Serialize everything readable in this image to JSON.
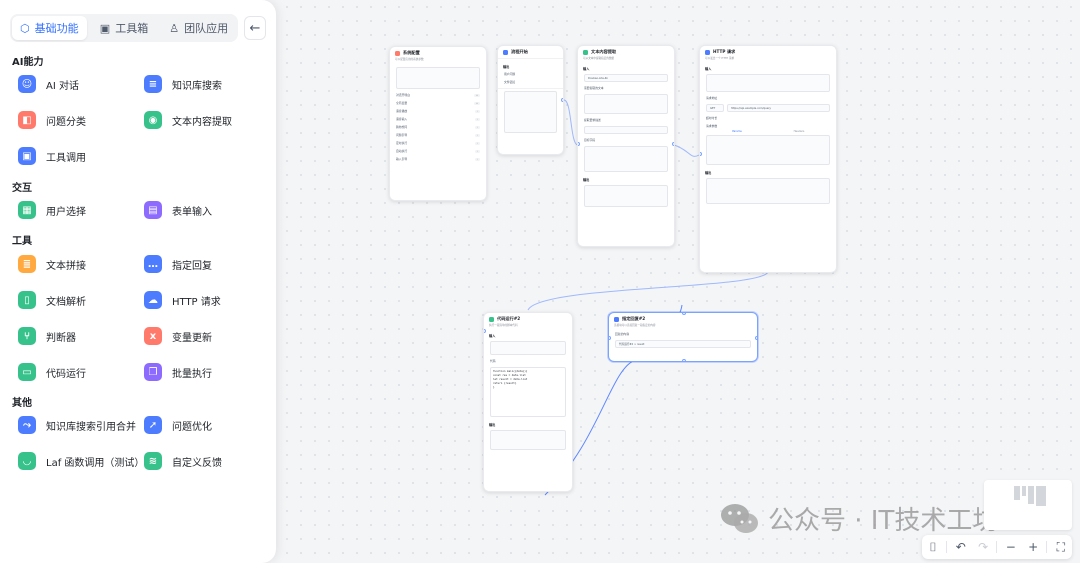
{
  "tabs": [
    {
      "label": "基础功能",
      "icon": "cube-icon",
      "active": true
    },
    {
      "label": "工具箱",
      "icon": "toolbox-icon",
      "active": false
    },
    {
      "label": "团队应用",
      "icon": "user-icon",
      "active": false
    }
  ],
  "sections": {
    "ai": "AI能力",
    "interaction": "交互",
    "tools": "工具",
    "other": "其他"
  },
  "items": {
    "ai_chat": {
      "label": "AI 对话",
      "color": "#4e7cff"
    },
    "kb_search": {
      "label": "知识库搜索",
      "color": "#4e7cff"
    },
    "classify": {
      "label": "问题分类",
      "color": "#ff7a6b"
    },
    "extract": {
      "label": "文本内容提取",
      "color": "#38c28b"
    },
    "tool_call": {
      "label": "工具调用",
      "color": "#4e7cff"
    },
    "user_select": {
      "label": "用户选择",
      "color": "#38c28b"
    },
    "form_input": {
      "label": "表单输入",
      "color": "#8e6bff"
    },
    "text_concat": {
      "label": "文本拼接",
      "color": "#ffa940"
    },
    "reply": {
      "label": "指定回复",
      "color": "#4e7cff"
    },
    "doc_parse": {
      "label": "文档解析",
      "color": "#38c28b"
    },
    "http": {
      "label": "HTTP 请求",
      "color": "#4e7cff"
    },
    "condition": {
      "label": "判断器",
      "color": "#38c28b"
    },
    "var_update": {
      "label": "变量更新",
      "color": "#ff7a6b"
    },
    "code_run": {
      "label": "代码运行",
      "color": "#38c28b"
    },
    "batch": {
      "label": "批量执行",
      "color": "#8e6bff"
    },
    "kb_merge": {
      "label": "知识库搜索引用合并",
      "color": "#4e7cff"
    },
    "optimize": {
      "label": "问题优化",
      "color": "#4e7cff"
    },
    "laf": {
      "label": "Laf 函数调用（测试）",
      "color": "#38c28b"
    },
    "feedback": {
      "label": "自定义反馈",
      "color": "#38c28b"
    }
  },
  "nodes": {
    "sys": {
      "title": "系统配置",
      "sub": "可以配置应用的系统参数",
      "rows": [
        "对话开场白",
        "全局变量",
        "语音播放",
        "语音输入",
        "猜你想问",
        "问题引导",
        "定时执行",
        "自动执行",
        "输入引导"
      ]
    },
    "start": {
      "title": "流程开始",
      "rows": [
        "用户问题",
        "文件链接"
      ]
    },
    "extract": {
      "title": "文本内容提取",
      "sub": "可从文本中提取指定的数据",
      "model": "Doubao-Lite-4k",
      "rows": [
        "需要提取的文本",
        "提取要求描述",
        "目标字段"
      ]
    },
    "http": {
      "title": "HTTP 请求",
      "sub": "可以发出一个 HTTP 请求",
      "method": "GET",
      "url": "https://api.example.com/query",
      "rows": [
        "请求地址",
        "超时时长",
        "请求参数",
        "Params",
        "Headers",
        "输出"
      ]
    },
    "code": {
      "title": "代码运行#2",
      "sub": "执行一段简单的脚本代码",
      "code": [
        "function main({data}){",
        "  const res = data.list",
        "  let result = data.list",
        "  return {result}",
        "}"
      ],
      "rows": [
        "代码",
        "输出"
      ]
    },
    "reply": {
      "title": "指定回复#2",
      "sub": "该模块可以直接回复一段指定的内容",
      "rows": [
        "回复的内容",
        "代码运行#2 > result"
      ]
    }
  },
  "watermark": {
    "text": "公众号 · IT技术工坊"
  },
  "controls": [
    {
      "name": "mouse-mode-icon",
      "glyph": "⌷"
    },
    {
      "name": "undo-icon",
      "glyph": "↶"
    },
    {
      "name": "redo-icon",
      "glyph": "↷"
    },
    {
      "name": "zoom-out-icon",
      "glyph": "−"
    },
    {
      "name": "zoom-in-icon",
      "glyph": "+"
    },
    {
      "name": "fit-view-icon",
      "glyph": "⛶"
    }
  ]
}
